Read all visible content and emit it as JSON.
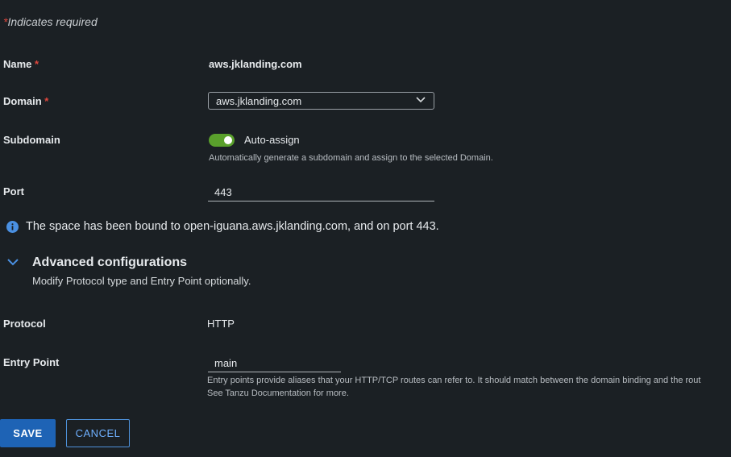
{
  "required_note": {
    "star": "*",
    "text": "Indicates required"
  },
  "fields": {
    "name": {
      "label": "Name",
      "star": "*",
      "value": "aws.jklanding.com"
    },
    "domain": {
      "label": "Domain",
      "star": "*",
      "selected": "aws.jklanding.com"
    },
    "subdomain": {
      "label": "Subdomain",
      "toggle_label": "Auto-assign",
      "toggle_on": true,
      "helper": "Automatically generate a subdomain and assign to the selected Domain."
    },
    "port": {
      "label": "Port",
      "value": "443"
    },
    "protocol": {
      "label": "Protocol",
      "value": "HTTP"
    },
    "entry_point": {
      "label": "Entry Point",
      "value": "main",
      "helper_line1": "Entry points provide aliases that your HTTP/TCP routes can refer to. It should match between the domain binding and the rout",
      "helper_line2": "See Tanzu Documentation for more."
    }
  },
  "info": {
    "icon": "info-icon",
    "text": "The space has been bound to open-iguana.aws.jklanding.com, and on port 443."
  },
  "advanced": {
    "title": "Advanced configurations",
    "subtitle": "Modify Protocol type and Entry Point optionally.",
    "expanded": true
  },
  "buttons": {
    "save": "SAVE",
    "cancel": "CANCEL"
  },
  "colors": {
    "background": "#1b2024",
    "accent": "#1e63b5",
    "toggle_on": "#5aa02c",
    "required": "#e0473d",
    "info": "#4a90e2"
  }
}
